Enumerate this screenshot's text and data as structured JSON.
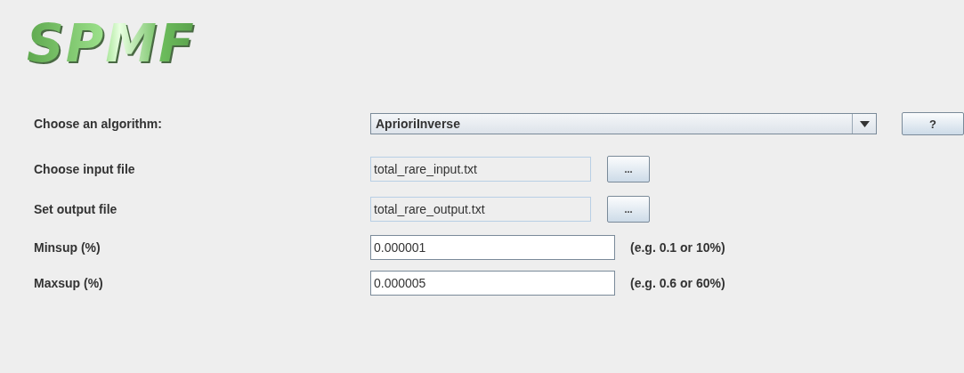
{
  "logo": {
    "text": "SPMF"
  },
  "rows": [
    {
      "kind": "combo",
      "label": "Choose an algorithm:",
      "value": "AprioriInverse",
      "help_button": "?"
    },
    {
      "kind": "file",
      "label": "Choose input file",
      "value": "total_rare_input.txt",
      "button": "..."
    },
    {
      "kind": "file",
      "label": "Set output file",
      "value": "total_rare_output.txt",
      "button": "..."
    },
    {
      "kind": "param",
      "label": "Minsup (%)",
      "value": "0.000001",
      "hint": "(e.g. 0.1 or 10%)"
    },
    {
      "kind": "param",
      "label": "Maxsup (%)",
      "value": "0.000005",
      "hint": "(e.g. 0.6 or 60%)"
    }
  ]
}
